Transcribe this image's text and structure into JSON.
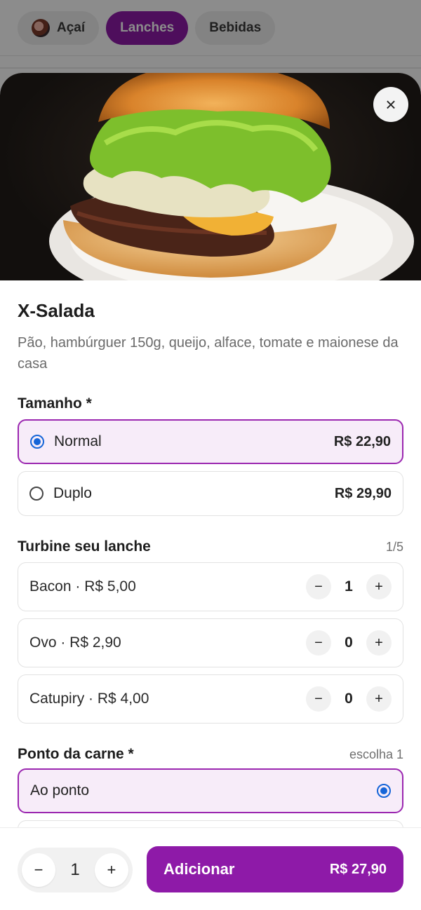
{
  "categories": [
    {
      "label": "Açaí",
      "active": false
    },
    {
      "label": "Lanches",
      "active": true
    },
    {
      "label": "Bebidas",
      "active": false
    }
  ],
  "product": {
    "title": "X-Salada",
    "description": "Pão, hambúrguer 150g, queijo, alface, tomate e maionese da casa",
    "close_icon": "×"
  },
  "size_section": {
    "title": "Tamanho *",
    "options": [
      {
        "label": "Normal",
        "price": "R$ 22,90",
        "selected": true
      },
      {
        "label": "Duplo",
        "price": "R$ 29,90",
        "selected": false
      }
    ]
  },
  "extras_section": {
    "title": "Turbine seu lanche",
    "meta": "1/5",
    "items": [
      {
        "label": "Bacon · R$ 5,00",
        "qty": "1"
      },
      {
        "label": "Ovo · R$ 2,90",
        "qty": "0"
      },
      {
        "label": "Catupiry · R$ 4,00",
        "qty": "0"
      }
    ],
    "minus": "−",
    "plus": "+"
  },
  "doneness_section": {
    "title": "Ponto da carne *",
    "meta": "escolha 1",
    "options": [
      {
        "label": "Ao ponto",
        "selected": true
      }
    ]
  },
  "footer": {
    "qty": "1",
    "minus": "−",
    "plus": "+",
    "add_label": "Adicionar",
    "add_price": "R$ 27,90"
  },
  "colors": {
    "brand": "#8e1aa8",
    "selected_border": "#9b27b0",
    "selected_bg": "#f7ecf9",
    "radio": "#1565d8"
  }
}
